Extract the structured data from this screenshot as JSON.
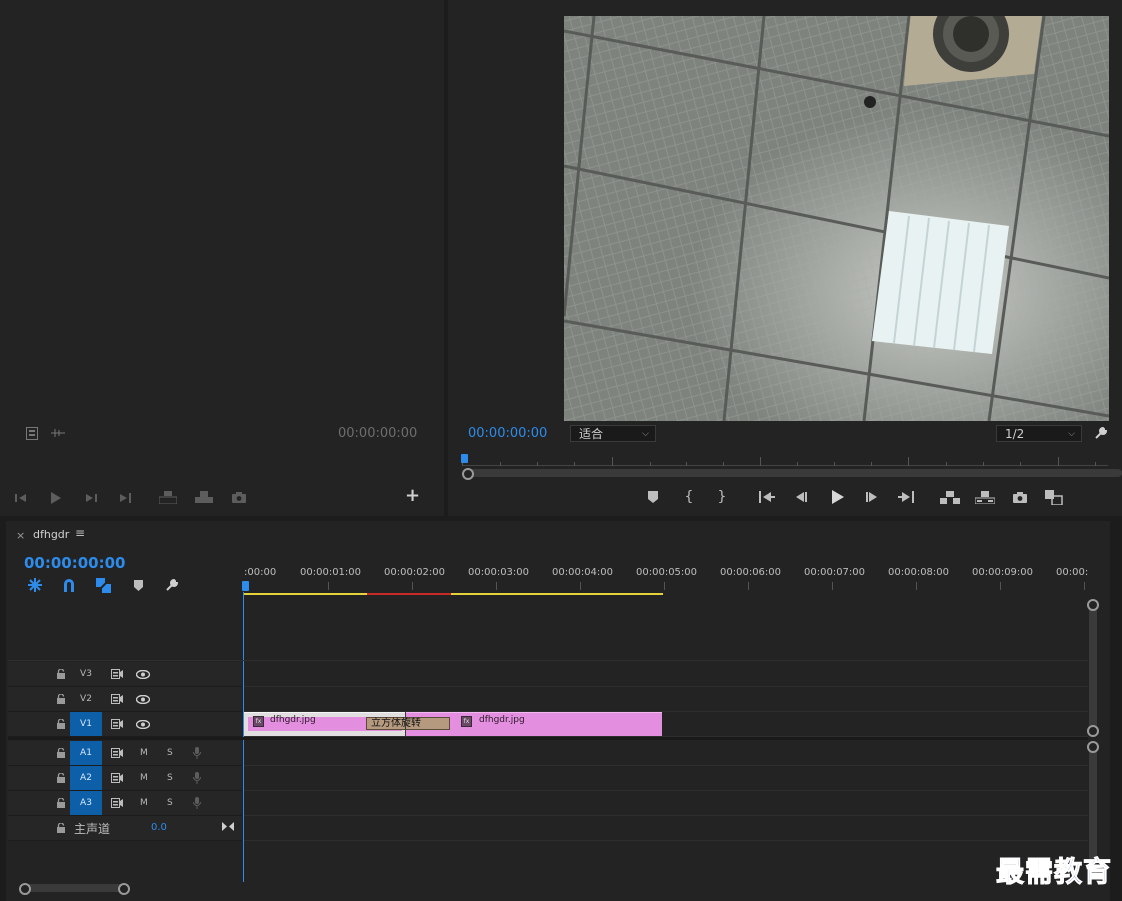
{
  "source_monitor": {
    "timecode": "00:00:00:00"
  },
  "program_monitor": {
    "timecode": "00:00:00:00",
    "zoom_select": "适合",
    "resolution_select": "1/2"
  },
  "timeline": {
    "close_symbol": "×",
    "sequence_name": "dfhgdr",
    "menu_symbol": "≡",
    "timecode": "00:00:00:00",
    "ruler_labels": [
      ":00:00",
      "00:00:01:00",
      "00:00:02:00",
      "00:00:03:00",
      "00:00:04:00",
      "00:00:05:00",
      "00:00:06:00",
      "00:00:07:00",
      "00:00:08:00",
      "00:00:09:00",
      "00:00:"
    ],
    "tracks": {
      "v3": "V3",
      "v2": "V2",
      "v1": "V1",
      "a1": "A1",
      "a2": "A2",
      "a3": "A3",
      "mute": "M",
      "solo": "S",
      "master_label": "主声道",
      "master_value": "0.0"
    },
    "clips": {
      "clip1_name": "dfhgdr.jpg",
      "clip2_name": "dfhgdr.jpg",
      "transition_name": "立方体旋转"
    }
  },
  "watermark": "最需教育",
  "colors": {
    "accent_blue": "#2d8ceb",
    "clip_pink": "#e48ee0",
    "transition_tan": "#b59a80",
    "render_yellow": "#e4d23a",
    "render_red": "#c82a2a"
  },
  "icons": [
    "marker-icon",
    "in-point-icon",
    "out-point-icon",
    "go-to-in-icon",
    "step-back-icon",
    "play-icon",
    "step-forward-icon",
    "go-to-out-icon",
    "lift-icon",
    "extract-icon",
    "camera-icon",
    "compare-icon",
    "snap-icon",
    "wrench-icon",
    "lock-icon",
    "eye-icon",
    "mic-icon"
  ]
}
